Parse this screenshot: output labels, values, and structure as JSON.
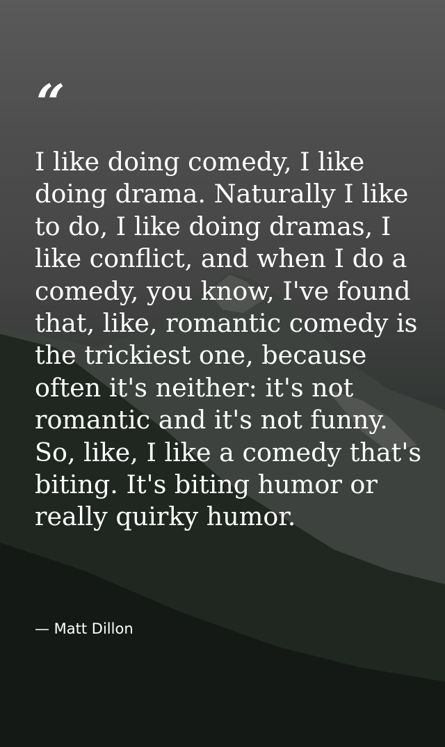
{
  "quote": {
    "mark": "“",
    "text": "I like doing comedy, I like doing drama. Naturally I like to do, I like doing dramas, I like conflict, and when I do a comedy, you know, I've found that, like, romantic comedy is the trickiest one, because often it's neither: it's not romantic and it's not funny. So, like, I like a comedy that's biting. It's biting humor or really quirky humor.",
    "author": "— Matt Dillon"
  },
  "colors": {
    "text": "#ffffff",
    "sky": "#666666",
    "forest": "#1b201d"
  }
}
